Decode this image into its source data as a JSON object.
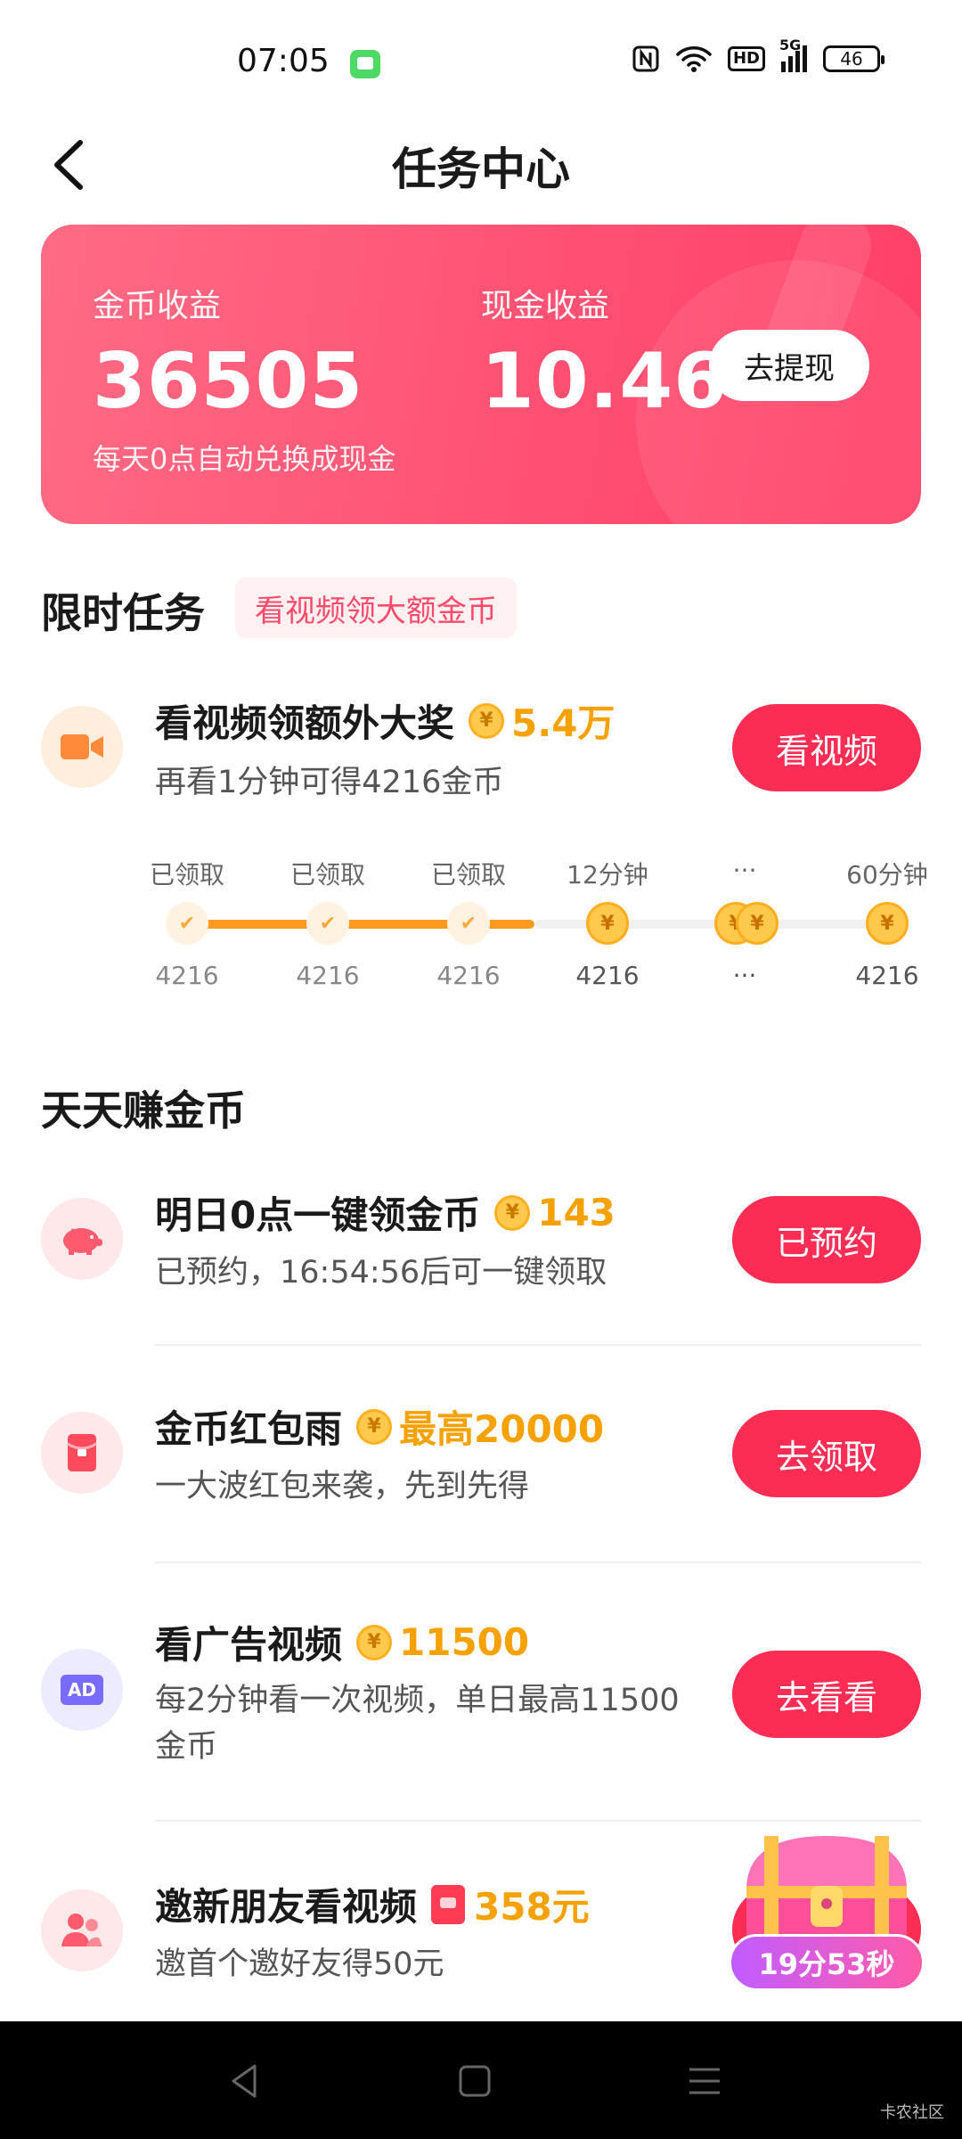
{
  "status_bar": {
    "time": "07:05",
    "network": "5G",
    "hd": "HD",
    "battery": "46"
  },
  "header": {
    "title": "任务中心"
  },
  "earnings": {
    "coin_label": "金币收益",
    "coin_value": "36505",
    "cash_label": "现金收益",
    "cash_value": "10.46",
    "withdraw_label": "去提现",
    "note": "每天0点自动兑换成现金"
  },
  "limited": {
    "title": "限时任务",
    "tag": "看视频领大额金币",
    "task": {
      "title": "看视频领额外大奖",
      "reward": "5.4万",
      "desc": "再看1分钟可得4216金币",
      "button": "看视频"
    },
    "progress": [
      {
        "top": "已领取",
        "bottom": "4216",
        "state": "done"
      },
      {
        "top": "已领取",
        "bottom": "4216",
        "state": "done"
      },
      {
        "top": "已领取",
        "bottom": "4216",
        "state": "done"
      },
      {
        "top": "12分钟",
        "bottom": "4216",
        "state": "coin"
      },
      {
        "top": "···",
        "bottom": "···",
        "state": "coin"
      },
      {
        "top": "60分钟",
        "bottom": "4216",
        "state": "coin"
      }
    ]
  },
  "daily": {
    "title": "天天赚金币",
    "tasks": [
      {
        "title": "明日0点一键领金币",
        "reward": "143",
        "desc": "已预约，16:54:56后可一键领取",
        "button": "已预约"
      },
      {
        "title": "金币红包雨",
        "reward": "最高20000",
        "desc": "一大波红包来袭，先到先得",
        "button": "去领取"
      },
      {
        "title": "看广告视频",
        "reward": "11500",
        "desc": "每2分钟看一次视频，单日最高11500金币",
        "button": "去看看",
        "icon_text": "AD"
      },
      {
        "title": "邀新朋友看视频",
        "reward": "358元",
        "desc": "邀首个邀好友得50元"
      }
    ]
  },
  "floating": {
    "timer": "19分53秒"
  },
  "watermark": "卡农社区",
  "colors": {
    "accent": "#fb2d55",
    "reward": "#f5a100",
    "card_start": "#ff6b84",
    "card_end": "#ff3f66"
  }
}
